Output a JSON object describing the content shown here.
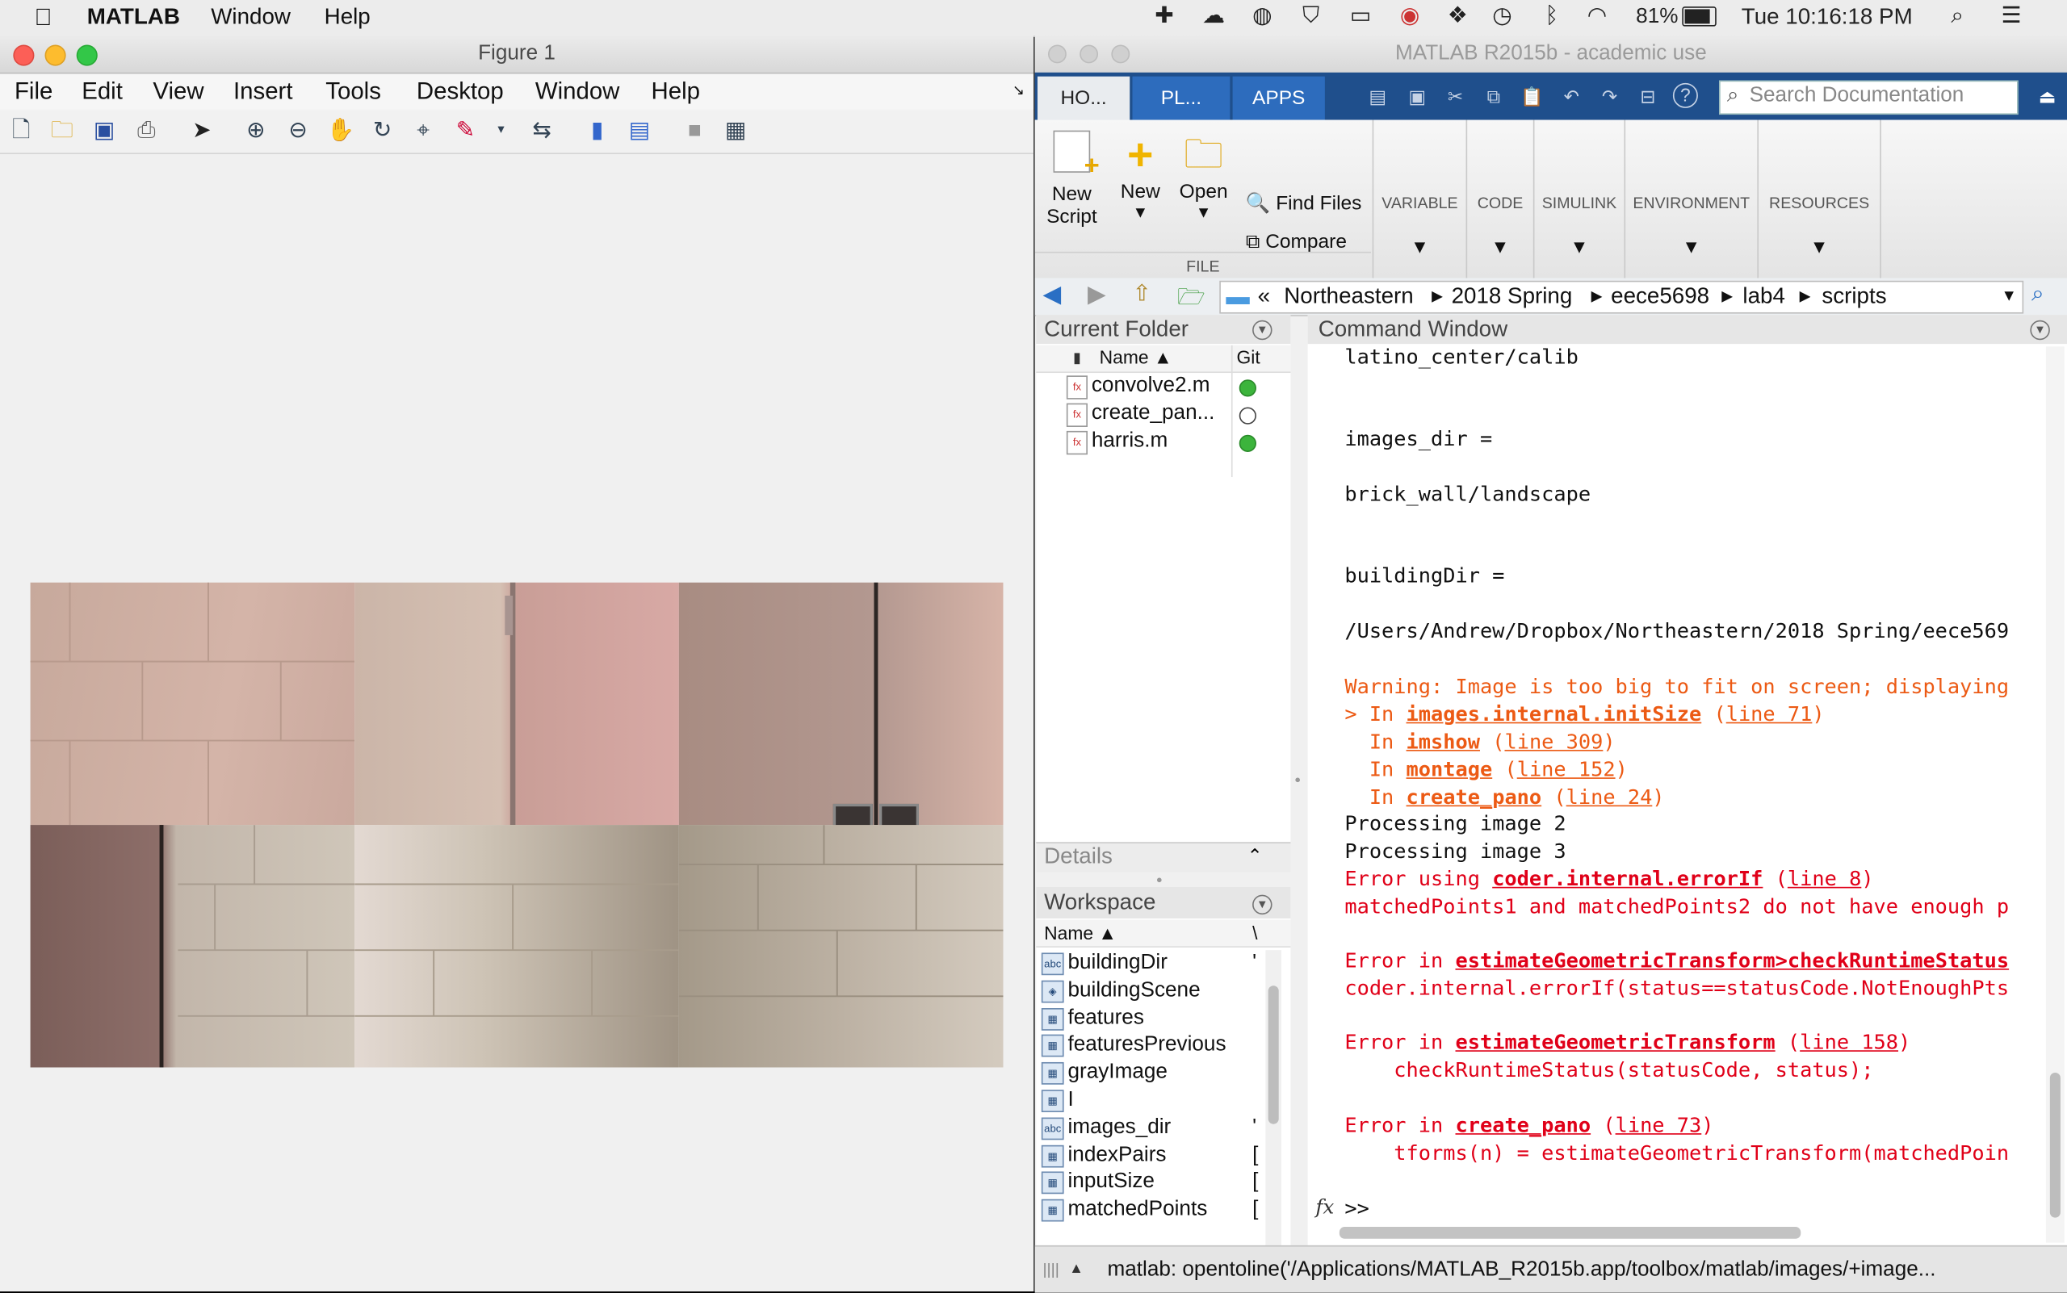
{
  "menubar": {
    "app_name": "MATLAB",
    "items": [
      "Window",
      "Help"
    ],
    "battery": "81%",
    "clock": "Tue 10:16:18 PM"
  },
  "figure": {
    "title": "Figure 1",
    "menu": [
      "File",
      "Edit",
      "View",
      "Insert",
      "Tools",
      "Desktop",
      "Window",
      "Help"
    ]
  },
  "main": {
    "title": "MATLAB R2015b - academic use",
    "tabs": [
      "HO...",
      "PL...",
      "APPS"
    ],
    "search_placeholder": "Search Documentation",
    "ribbon": {
      "new_script": "New Script",
      "new": "New",
      "open": "Open",
      "find_files": "Find Files",
      "compare": "Compare",
      "file_label": "FILE",
      "sections": [
        "VARIABLE",
        "CODE",
        "SIMULINK",
        "ENVIRONMENT",
        "RESOURCES"
      ]
    },
    "path": [
      "«",
      "Northeastern",
      "2018 Spring",
      "eece5698",
      "lab4",
      "scripts"
    ]
  },
  "current_folder": {
    "title": "Current Folder",
    "col_name": "Name ▲",
    "col_git": "Git",
    "files": [
      {
        "name": "convolve2.m",
        "git": "#3cb43c"
      },
      {
        "name": "create_pan...",
        "git": "#ffffff"
      },
      {
        "name": "harris.m",
        "git": "#3cb43c"
      }
    ],
    "details_label": "Details"
  },
  "workspace": {
    "title": "Workspace",
    "col_name": "Name ▲",
    "col_value": "\\",
    "vars": [
      {
        "name": "buildingDir",
        "icon": "abc",
        "v": "'"
      },
      {
        "name": "buildingScene",
        "icon": "obj",
        "v": ""
      },
      {
        "name": "features",
        "icon": "grid",
        "v": ""
      },
      {
        "name": "featuresPrevious",
        "icon": "grid",
        "v": ""
      },
      {
        "name": "grayImage",
        "icon": "grid",
        "v": ""
      },
      {
        "name": "I",
        "icon": "grid",
        "v": ""
      },
      {
        "name": "images_dir",
        "icon": "abc",
        "v": "'"
      },
      {
        "name": "indexPairs",
        "icon": "grid",
        "v": "["
      },
      {
        "name": "inputSize",
        "icon": "grid",
        "v": "["
      },
      {
        "name": "matchedPoints",
        "icon": "grid",
        "v": "["
      }
    ]
  },
  "command_window": {
    "title": "Command Window",
    "l1": "latino_center/calib",
    "l2": "images_dir =",
    "l3": "brick_wall/landscape",
    "l4": "buildingDir =",
    "l5": "/Users/Andrew/Dropbox/Northeastern/2018 Spring/eece569",
    "w1": "Warning: Image is too big to fit on screen; displaying",
    "w2a": "> In ",
    "w2b": "images.internal.initSize",
    "w2c": " (",
    "w2d": "line 71",
    "w2e": ")",
    "w3a": "  In ",
    "w3b": "imshow",
    "w3d": "line 309",
    "w4a": "  In ",
    "w4b": "montage",
    "w4d": "line 152",
    "w5a": "  In ",
    "w5b": "create_pano",
    "w5d": "line 24",
    "p2": "Processing image 2",
    "p3": "Processing image 3",
    "e1a": "Error using ",
    "e1b": "coder.internal.errorIf",
    "e1d": "line 8",
    "e2": "matchedPoints1 and matchedPoints2 do not have enough p",
    "e3a": "Error in ",
    "e3b": "estimateGeometricTransform>checkRuntimeStatus",
    "e4": "coder.internal.errorIf(status==statusCode.NotEnoughPts",
    "e5a": "Error in ",
    "e5b": "estimateGeometricTransform",
    "e5d": "line 158",
    "e6": "    checkRuntimeStatus(statusCode, status);",
    "e7a": "Error in ",
    "e7b": "create_pano",
    "e7d": "line 73",
    "e8": "    tforms(n) = estimateGeometricTransform(matchedPoin",
    "prompt": ">>",
    "fx": "fx"
  },
  "status_bar": {
    "text": "matlab: opentoline('/Applications/MATLAB_R2015b.app/toolbox/matlab/images/+image..."
  }
}
